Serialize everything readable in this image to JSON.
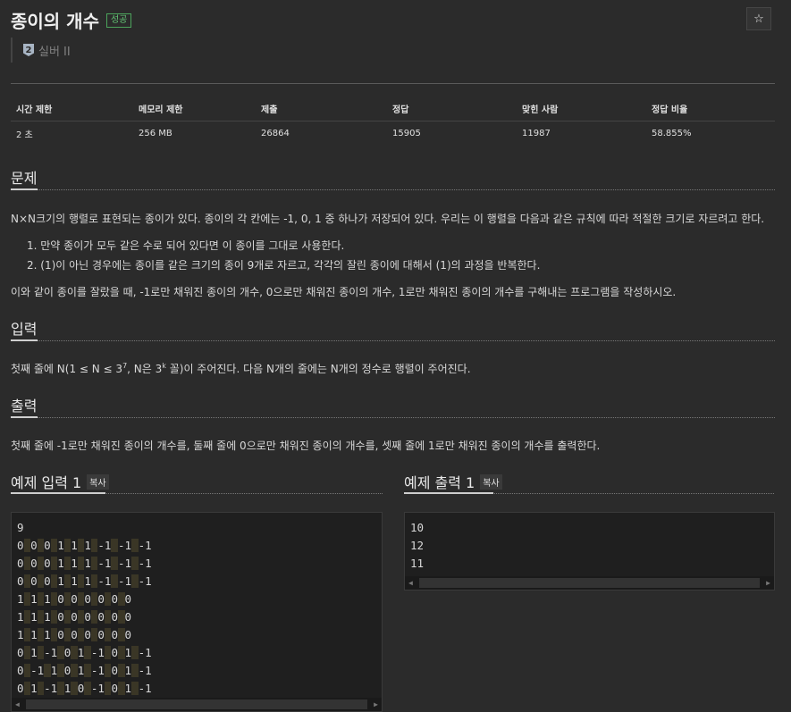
{
  "header": {
    "title": "종이의 개수",
    "badge": "성공",
    "star": "☆",
    "tier_num": "2",
    "tier": "실버 II"
  },
  "stats": {
    "headers": [
      "시간 제한",
      "메모리 제한",
      "제출",
      "정답",
      "맞힌 사람",
      "정답 비율"
    ],
    "values": [
      "2 초",
      "256 MB",
      "26864",
      "15905",
      "11987",
      "58.855%"
    ]
  },
  "problem": {
    "heading": "문제",
    "intro": "N×N크기의 행렬로 표현되는 종이가 있다. 종이의 각 칸에는 -1, 0, 1 중 하나가 저장되어 있다. 우리는 이 행렬을 다음과 같은 규칙에 따라 적절한 크기로 자르려고 한다.",
    "rules": [
      "1.  만약 종이가 모두 같은 수로 되어 있다면 이 종이를 그대로 사용한다.",
      "2.  (1)이 아닌 경우에는 종이를 같은 크기의 종이 9개로 자르고, 각각의 잘린 종이에 대해서 (1)의 과정을 반복한다."
    ],
    "outro": "이와 같이 종이를 잘랐을 때, -1로만 채워진 종이의 개수, 0으로만 채워진 종이의 개수, 1로만 채워진 종이의 개수를 구해내는 프로그램을 작성하시오."
  },
  "input": {
    "heading": "입력",
    "p1": "첫째 줄에 N(1 ≤ N ≤ 3",
    "sup1": "7",
    "p2": ", N은 3",
    "sup2": "k",
    "p3": " 꼴)이 주어진다. 다음 N개의 줄에는 N개의 정수로 행렬이 주어진다."
  },
  "output": {
    "heading": "출력",
    "text": "첫째 줄에 -1로만 채워진 종이의 개수를, 둘째 줄에 0으로만 채워진 종이의 개수를, 셋째 줄에 1로만 채워진 종이의 개수를 출력한다."
  },
  "sample_input": {
    "title": "예제 입력 1",
    "copy": "복사",
    "first": "9",
    "rows": [
      [
        "0",
        "0",
        "0",
        "1",
        "1",
        "1",
        "-1",
        "-1",
        "-1"
      ],
      [
        "0",
        "0",
        "0",
        "1",
        "1",
        "1",
        "-1",
        "-1",
        "-1"
      ],
      [
        "0",
        "0",
        "0",
        "1",
        "1",
        "1",
        "-1",
        "-1",
        "-1"
      ],
      [
        "1",
        "1",
        "1",
        "0",
        "0",
        "0",
        "0",
        "0",
        "0"
      ],
      [
        "1",
        "1",
        "1",
        "0",
        "0",
        "0",
        "0",
        "0",
        "0"
      ],
      [
        "1",
        "1",
        "1",
        "0",
        "0",
        "0",
        "0",
        "0",
        "0"
      ],
      [
        "0",
        "1",
        "-1",
        "0",
        "1",
        "-1",
        "0",
        "1",
        "-1"
      ],
      [
        "0",
        "-1",
        "1",
        "0",
        "1",
        "-1",
        "0",
        "1",
        "-1"
      ],
      [
        "0",
        "1",
        "-1",
        "1",
        "0",
        "-1",
        "0",
        "1",
        "-1"
      ]
    ]
  },
  "sample_output": {
    "title": "예제 출력 1",
    "copy": "복사",
    "lines": [
      "10",
      "12",
      "11"
    ]
  }
}
